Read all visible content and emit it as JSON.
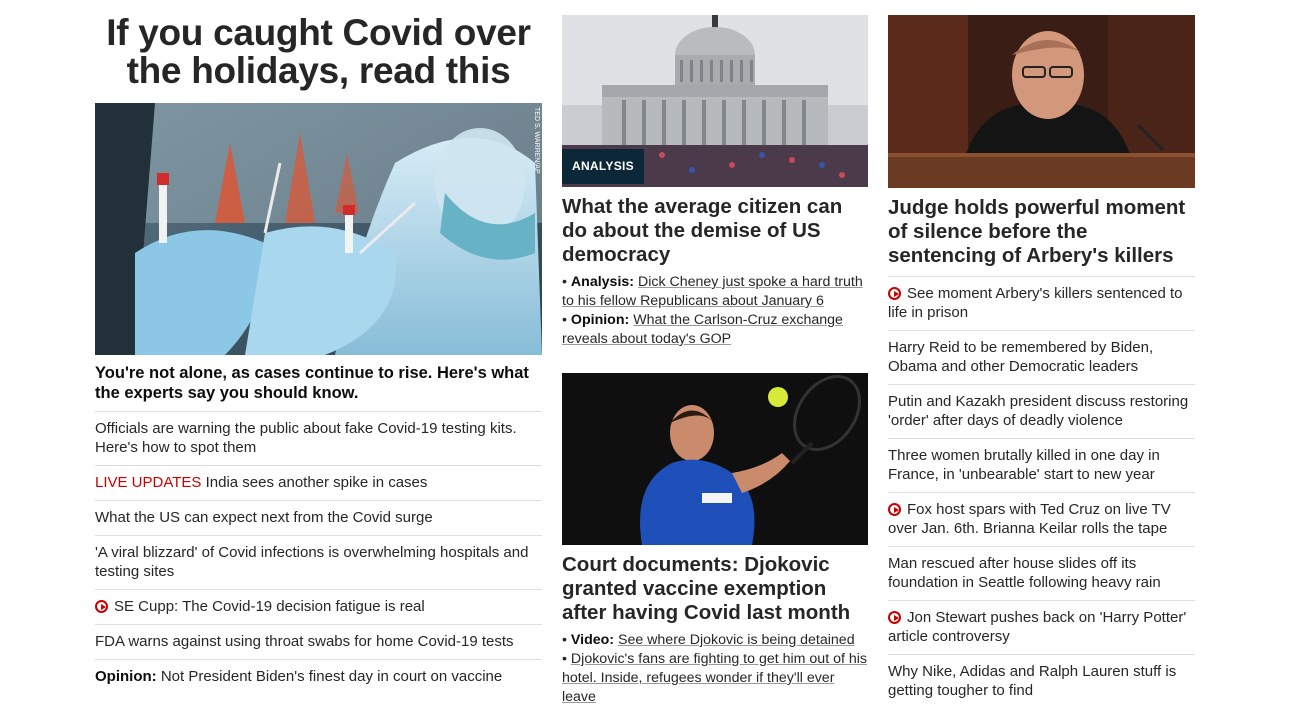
{
  "lead": {
    "headline": "If you caught Covid over the holidays, read this",
    "photo_credit": "TED S. WARREN/AP",
    "subheadline": "You're not alone, as cases continue to rise. Here's what the experts say you should know.",
    "items": [
      {
        "text": "Officials are warning the public about fake Covid-19 testing kits. Here's how to spot them"
      },
      {
        "live": "LIVE UPDATES",
        "text": " India sees another spike in cases"
      },
      {
        "text": "What the US can expect next from the Covid surge"
      },
      {
        "text": "'A viral blizzard' of Covid infections is overwhelming hospitals and testing sites"
      },
      {
        "video": true,
        "text": "SE Cupp: The Covid-19 decision fatigue is real"
      },
      {
        "text": "FDA warns against using throat swabs for home Covid-19 tests"
      },
      {
        "prefix": "Opinion:",
        "text": " Not President Biden's finest day in court on vaccine"
      }
    ]
  },
  "middle": {
    "story1": {
      "badge": "ANALYSIS",
      "headline": "What the average citizen can do about the demise of US democracy",
      "bullets": [
        {
          "prefix": "Analysis:",
          "text": "Dick Cheney just spoke a hard truth to his fellow Republicans about January 6"
        },
        {
          "prefix": "Opinion:",
          "text": "What the Carlson-Cruz exchange reveals about today's GOP"
        }
      ]
    },
    "story2": {
      "headline": "Court documents: Djokovic granted vaccine exemption after having Covid last month",
      "bullets": [
        {
          "prefix": "Video:",
          "text": "See where Djokovic is being detained"
        },
        {
          "prefix": "",
          "text": "Djokovic's fans are fighting to get him out of his hotel. Inside, refugees wonder if they'll ever leave"
        }
      ]
    }
  },
  "right": {
    "headline": "Judge holds powerful moment of silence before the sentencing of Arbery's killers",
    "items": [
      {
        "video": true,
        "text": "See moment Arbery's killers sentenced to life in prison"
      },
      {
        "text": "Harry Reid to be remembered by Biden, Obama and other Democratic leaders"
      },
      {
        "text": "Putin and Kazakh president discuss restoring 'order' after days of deadly violence"
      },
      {
        "text": "Three women brutally killed in one day in France, in 'unbearable' start to new year"
      },
      {
        "video": true,
        "text": "Fox host spars with Ted Cruz on live TV over Jan. 6th. Brianna Keilar rolls the tape"
      },
      {
        "text": "Man rescued after house slides off its foundation in Seattle following heavy rain"
      },
      {
        "video": true,
        "text": "Jon Stewart pushes back on 'Harry Potter' article controversy"
      },
      {
        "text": "Why Nike, Adidas and Ralph Lauren stuff is getting tougher to find"
      }
    ]
  },
  "colors": {
    "live": "#cc0000",
    "badge": "#0c2737",
    "divider": "#dedede"
  }
}
